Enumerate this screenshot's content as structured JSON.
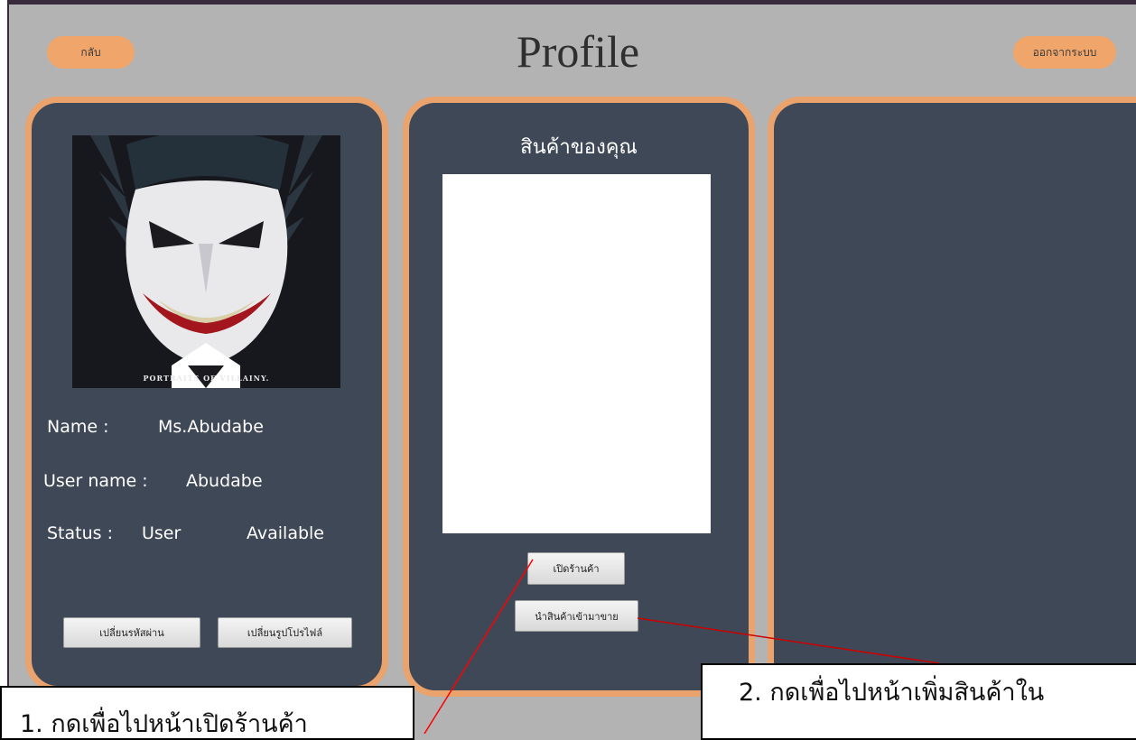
{
  "header": {
    "back_label": "กลับ",
    "title": "Profile",
    "logout_label": "ออกจากระบบ"
  },
  "profile": {
    "image_caption": "PORTRAITS OF VILLAINY.",
    "name_label": "Name :",
    "name_value": "Ms.Abudabe",
    "username_label": "User name :",
    "username_value": "Abudabe",
    "status_label": "Status :",
    "status_value": "User",
    "availability": "Available",
    "change_password_label": "เปลี่ยนรหัสผ่าน",
    "change_picture_label": "เปลี่ยนรูปโปรไฟล์"
  },
  "products": {
    "title": "สินค้าของคุณ",
    "open_shop_label": "เปิดร้านค้า",
    "add_product_label": "นำสินค้าเข้ามาขาย"
  },
  "annotations": {
    "note1": "1. กดเพื่อไปหน้าเปิดร้านค้า",
    "note2": "2. กดเพื่อไปหน้าเพิ่มสินค้าใน"
  }
}
